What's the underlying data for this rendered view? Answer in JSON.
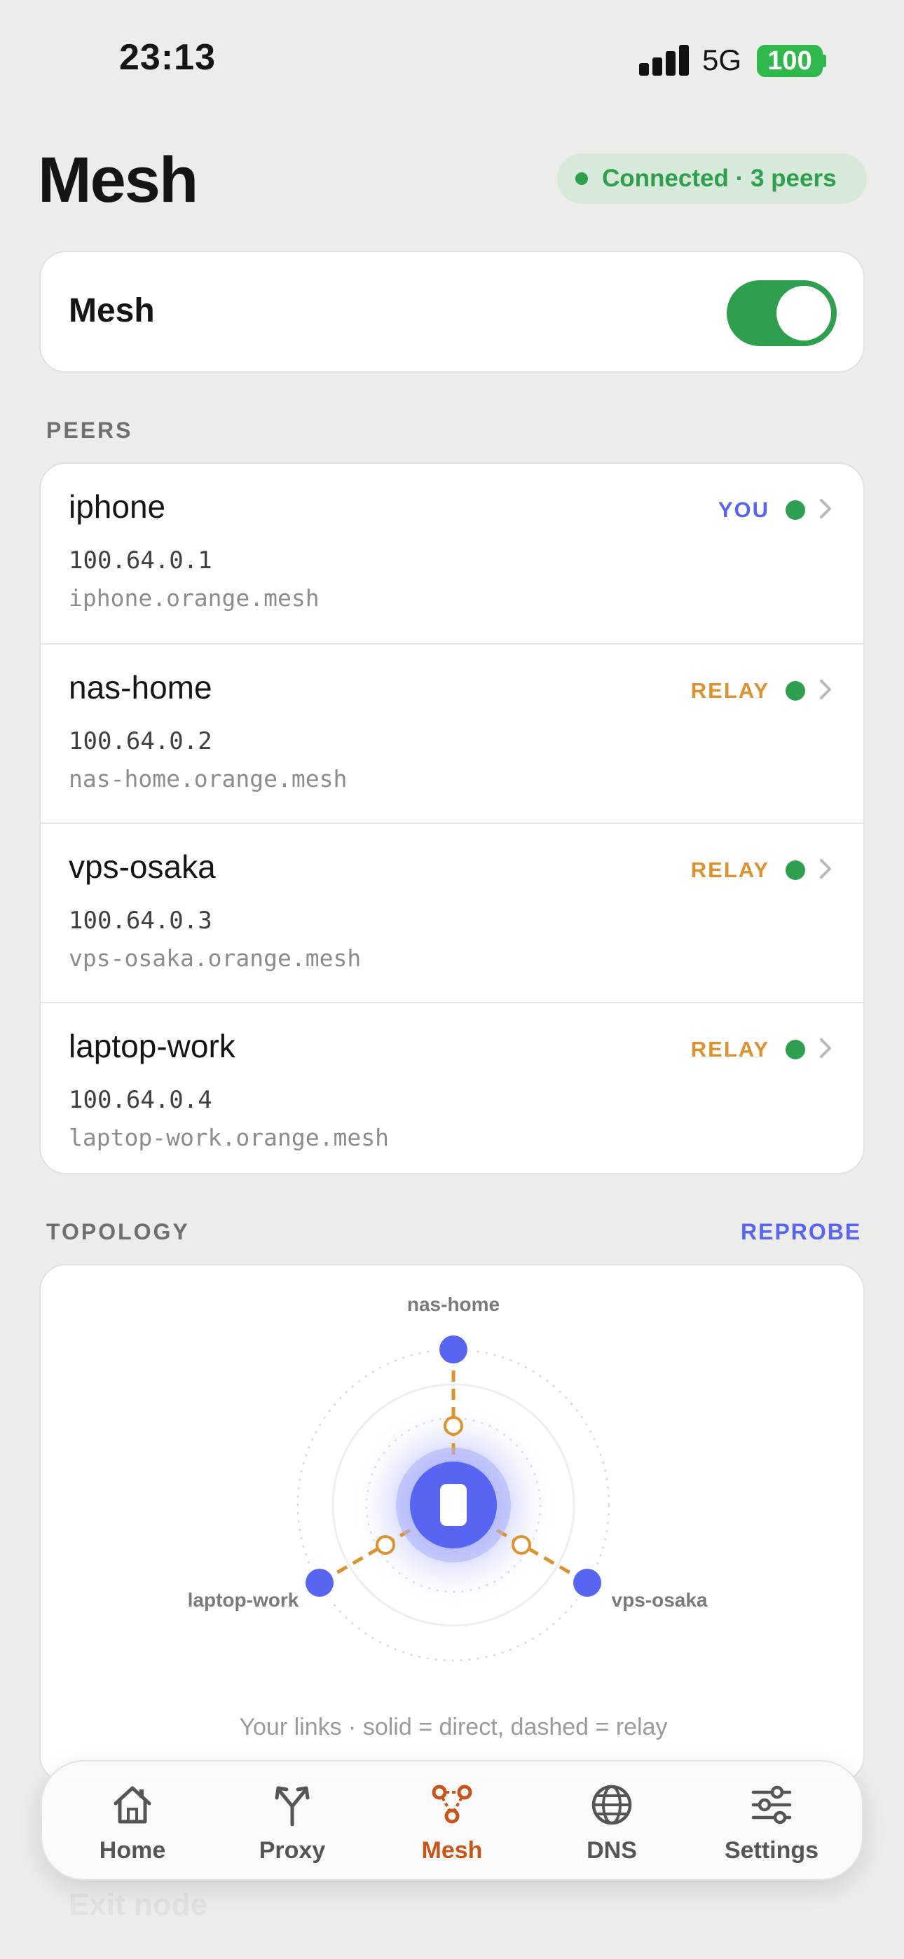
{
  "status_bar": {
    "time": "23:13",
    "network": "5G",
    "battery": "100"
  },
  "header": {
    "title": "Mesh",
    "connection_status": "Connected · 3 peers"
  },
  "mesh_toggle": {
    "label": "Mesh",
    "enabled": true
  },
  "peers": {
    "section_label": "PEERS",
    "items": [
      {
        "name": "iphone",
        "ip": "100.64.0.1",
        "hostname": "iphone.orange.mesh",
        "tag": "YOU",
        "tag_color": "#5865f2"
      },
      {
        "name": "nas-home",
        "ip": "100.64.0.2",
        "hostname": "nas-home.orange.mesh",
        "tag": "RELAY",
        "tag_color": "#e0912f"
      },
      {
        "name": "vps-osaka",
        "ip": "100.64.0.3",
        "hostname": "vps-osaka.orange.mesh",
        "tag": "RELAY",
        "tag_color": "#e0912f"
      },
      {
        "name": "laptop-work",
        "ip": "100.64.0.4",
        "hostname": "laptop-work.orange.mesh",
        "tag": "RELAY",
        "tag_color": "#e0912f"
      }
    ]
  },
  "topology": {
    "section_label": "TOPOLOGY",
    "action_label": "REPROBE",
    "nodes": [
      "nas-home",
      "laptop-work",
      "vps-osaka"
    ],
    "caption": "Your links · solid = direct, dashed = relay"
  },
  "background_item": "Exit node",
  "tab_bar": {
    "tabs": [
      {
        "label": "Home",
        "icon": "house-icon"
      },
      {
        "label": "Proxy",
        "icon": "fork-arrow-icon"
      },
      {
        "label": "Mesh",
        "icon": "mesh-network-icon",
        "active": true
      },
      {
        "label": "DNS",
        "icon": "globe-icon"
      },
      {
        "label": "Settings",
        "icon": "sliders-icon"
      }
    ]
  },
  "colors": {
    "accent": "#5865f2",
    "relay": "#e0912f",
    "online": "#2e9e4f",
    "active_tab": "#c8541a",
    "background": "#ececeb"
  }
}
